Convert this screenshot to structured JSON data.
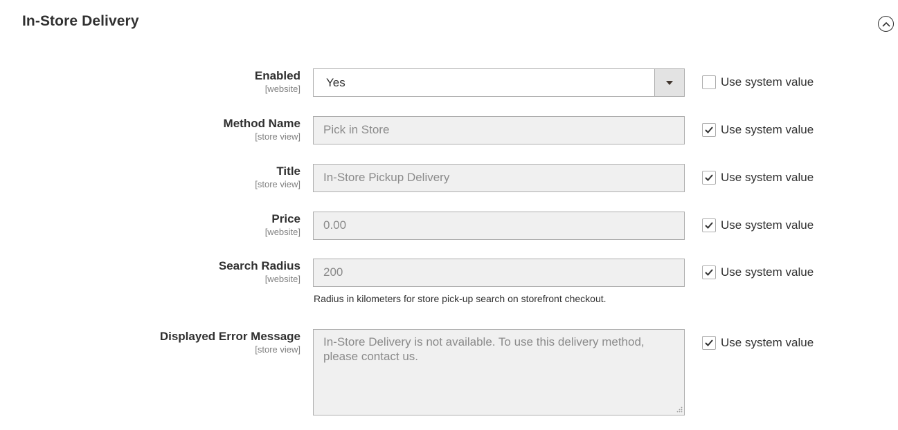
{
  "section": {
    "title": "In-Store Delivery"
  },
  "fields": {
    "enabled": {
      "label": "Enabled",
      "scope": "[website]",
      "value": "Yes",
      "use_system_label": "Use system value",
      "use_system_checked": false
    },
    "method_name": {
      "label": "Method Name",
      "scope": "[store view]",
      "value": "Pick in Store",
      "use_system_label": "Use system value",
      "use_system_checked": true
    },
    "title": {
      "label": "Title",
      "scope": "[store view]",
      "value": "In-Store Pickup Delivery",
      "use_system_label": "Use system value",
      "use_system_checked": true
    },
    "price": {
      "label": "Price",
      "scope": "[website]",
      "value": "0.00",
      "use_system_label": "Use system value",
      "use_system_checked": true
    },
    "search_radius": {
      "label": "Search Radius",
      "scope": "[website]",
      "value": "200",
      "note": "Radius in kilometers for store pick-up search on storefront checkout.",
      "use_system_label": "Use system value",
      "use_system_checked": true
    },
    "error_message": {
      "label": "Displayed Error Message",
      "scope": "[store view]",
      "value": "In-Store Delivery is not available. To use this delivery method, please contact us.",
      "use_system_label": "Use system value",
      "use_system_checked": true
    }
  },
  "icons": {
    "collapse": "chevron-up-circle-icon",
    "dropdown": "caret-down-icon",
    "check": "checkmark-icon",
    "resize": "resize-grip-icon"
  },
  "colors": {
    "text": "#303030",
    "muted": "#808080",
    "disabled_bg": "#f0f0f0",
    "border": "#adadad"
  }
}
